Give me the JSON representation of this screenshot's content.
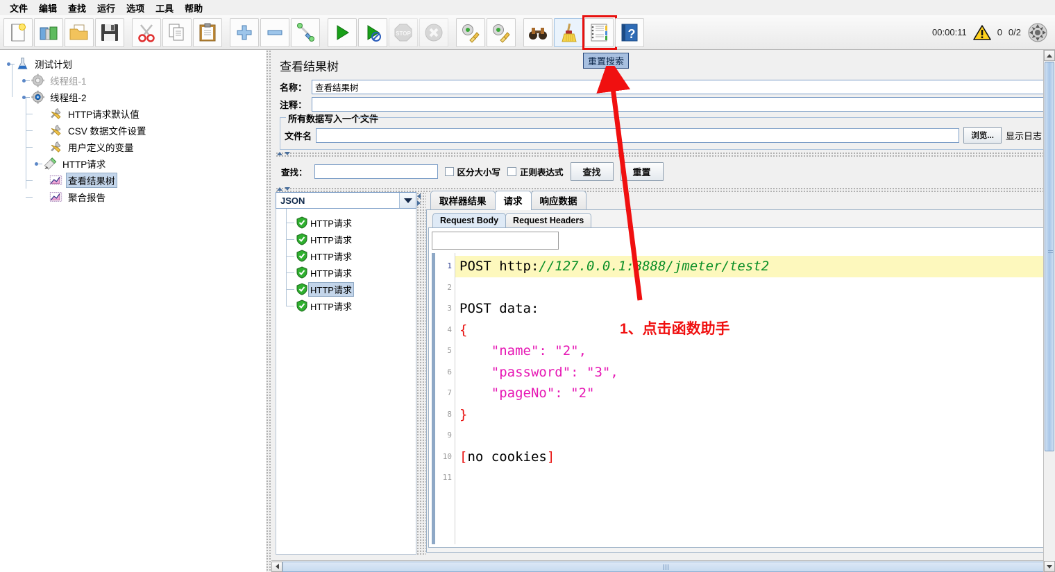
{
  "menu": {
    "items": [
      "文件",
      "编辑",
      "查找",
      "运行",
      "选项",
      "工具",
      "帮助"
    ]
  },
  "toolbar": {
    "buttons": [
      {
        "name": "new-test-plan",
        "icon": "new-document-icon",
        "title": "新建"
      },
      {
        "name": "templates",
        "icon": "templates-icon",
        "title": "模板"
      },
      {
        "name": "open",
        "icon": "open-folder-icon",
        "title": "打开"
      },
      {
        "name": "save",
        "icon": "save-disk-icon",
        "title": "保存"
      },
      {
        "name": "cut",
        "icon": "scissors-icon",
        "title": "剪切"
      },
      {
        "name": "copy",
        "icon": "copy-icon",
        "title": "复制"
      },
      {
        "name": "paste",
        "icon": "clipboard-paste-icon",
        "title": "粘贴"
      },
      {
        "name": "expand-all",
        "icon": "plus-icon",
        "title": "展开全部"
      },
      {
        "name": "collapse-all",
        "icon": "minus-icon",
        "title": "折叠全部"
      },
      {
        "name": "toggle",
        "icon": "toggle-icon",
        "title": "切换"
      },
      {
        "name": "start",
        "icon": "play-green-icon",
        "title": "启动"
      },
      {
        "name": "start-no-pauses",
        "icon": "play-no-pause-icon",
        "title": "无暂停启动"
      },
      {
        "name": "stop",
        "icon": "stop-sign-icon",
        "title": "停止"
      },
      {
        "name": "shutdown",
        "icon": "shutdown-x-icon",
        "title": "关闭"
      },
      {
        "name": "clear",
        "icon": "gear-broom-icon",
        "title": "清除"
      },
      {
        "name": "clear-all",
        "icon": "gear-broom-all-icon",
        "title": "清除全部"
      },
      {
        "name": "search",
        "icon": "binoculars-icon",
        "title": "搜索"
      },
      {
        "name": "reset-search",
        "icon": "broom-icon",
        "title": "重置搜索"
      },
      {
        "name": "function-helper",
        "icon": "function-helper-icon",
        "title": "函数助手对话框"
      },
      {
        "name": "help",
        "icon": "help-book-icon",
        "title": "帮助"
      }
    ],
    "status": {
      "clock": "00:00:11",
      "warning_icon": "warning-triangle-icon",
      "warning_count": "0",
      "threads": "0/2",
      "connection_icon": "connection-target-icon"
    }
  },
  "tree": {
    "nodes": [
      {
        "label": "测试计划",
        "icon": "test-plan-icon",
        "depth": 0,
        "selected": false,
        "dim": false,
        "handle": true
      },
      {
        "label": "线程组-1",
        "icon": "thread-group-gray-icon",
        "depth": 1,
        "selected": false,
        "dim": true,
        "handle": true
      },
      {
        "label": "线程组-2",
        "icon": "thread-group-icon",
        "depth": 1,
        "selected": false,
        "dim": false,
        "handle": true
      },
      {
        "label": "HTTP请求默认值",
        "icon": "config-wrench-icon",
        "depth": 2,
        "selected": false,
        "dim": false,
        "handle": false
      },
      {
        "label": "CSV 数据文件设置",
        "icon": "config-wrench-icon",
        "depth": 2,
        "selected": false,
        "dim": false,
        "handle": false
      },
      {
        "label": "用户定义的变量",
        "icon": "config-wrench-icon",
        "depth": 2,
        "selected": false,
        "dim": false,
        "handle": false
      },
      {
        "label": "HTTP请求",
        "icon": "sampler-pen-icon",
        "depth": 2,
        "selected": false,
        "dim": false,
        "handle": true
      },
      {
        "label": "查看结果树",
        "icon": "listener-chart-icon",
        "depth": 2,
        "selected": true,
        "dim": false,
        "handle": false
      },
      {
        "label": "聚合报告",
        "icon": "listener-chart-icon",
        "depth": 2,
        "selected": false,
        "dim": false,
        "handle": false
      }
    ]
  },
  "panel": {
    "title": "查看结果树",
    "name_label": "名称：",
    "name_value": "查看结果树",
    "comment_label": "注释：",
    "comment_value": "",
    "group_title": "所有数据写入一个文件",
    "filename_label": "文件名",
    "filename_value": "",
    "browse_button": "浏览...",
    "show_log_label": "显示日志",
    "search_label": "查找：",
    "search_value": "",
    "case_sensitive_label": "区分大小写",
    "regex_label": "正则表达式",
    "find_button": "查找",
    "reset_button": "重置"
  },
  "results": {
    "render_selector": "JSON",
    "sampler_nodes": [
      {
        "label": "HTTP请求",
        "status": "success",
        "selected": false
      },
      {
        "label": "HTTP请求",
        "status": "success",
        "selected": false
      },
      {
        "label": "HTTP请求",
        "status": "success",
        "selected": false
      },
      {
        "label": "HTTP请求",
        "status": "success",
        "selected": false
      },
      {
        "label": "HTTP请求",
        "status": "success",
        "selected": true
      },
      {
        "label": "HTTP请求",
        "status": "success",
        "selected": false
      }
    ],
    "tabs": [
      {
        "label": "取样器结果",
        "selected": false
      },
      {
        "label": "请求",
        "selected": true
      },
      {
        "label": "响应数据",
        "selected": false
      }
    ],
    "subtabs": [
      {
        "label": "Request Body",
        "selected": true
      },
      {
        "label": "Request Headers",
        "selected": false
      }
    ],
    "search_field_value": "",
    "code_lines": [
      {
        "n": "1",
        "highlight": true,
        "current": true,
        "tokens": [
          {
            "t": "POST ",
            "c": "black"
          },
          {
            "t": "http:",
            "c": "black"
          },
          {
            "t": "//127.0.0.1:8888/jmeter/test2",
            "c": "green"
          }
        ]
      },
      {
        "n": "2",
        "highlight": false,
        "current": false,
        "tokens": []
      },
      {
        "n": "3",
        "highlight": false,
        "current": false,
        "tokens": [
          {
            "t": "POST data:",
            "c": "black"
          }
        ]
      },
      {
        "n": "4",
        "highlight": false,
        "current": false,
        "tokens": [
          {
            "t": "{",
            "c": "red"
          }
        ]
      },
      {
        "n": "5",
        "highlight": false,
        "current": false,
        "tokens": [
          {
            "t": "    \"name\": \"2\",",
            "c": "pink"
          }
        ]
      },
      {
        "n": "6",
        "highlight": false,
        "current": false,
        "tokens": [
          {
            "t": "    \"password\": \"3\",",
            "c": "pink"
          }
        ]
      },
      {
        "n": "7",
        "highlight": false,
        "current": false,
        "tokens": [
          {
            "t": "    \"pageNo\": \"2\"",
            "c": "pink"
          }
        ]
      },
      {
        "n": "8",
        "highlight": false,
        "current": false,
        "tokens": [
          {
            "t": "}",
            "c": "red"
          }
        ]
      },
      {
        "n": "9",
        "highlight": false,
        "current": false,
        "tokens": []
      },
      {
        "n": "10",
        "highlight": false,
        "current": false,
        "tokens": [
          {
            "t": "[",
            "c": "red"
          },
          {
            "t": "no cookies",
            "c": "black"
          },
          {
            "t": "]",
            "c": "red"
          }
        ]
      },
      {
        "n": "11",
        "highlight": false,
        "current": false,
        "tokens": []
      }
    ]
  },
  "annotation": {
    "text": "1、点击函数助手",
    "tooltip": "重置搜索",
    "arrow_color": "#f01010",
    "highlight_color": "#e8110f"
  }
}
